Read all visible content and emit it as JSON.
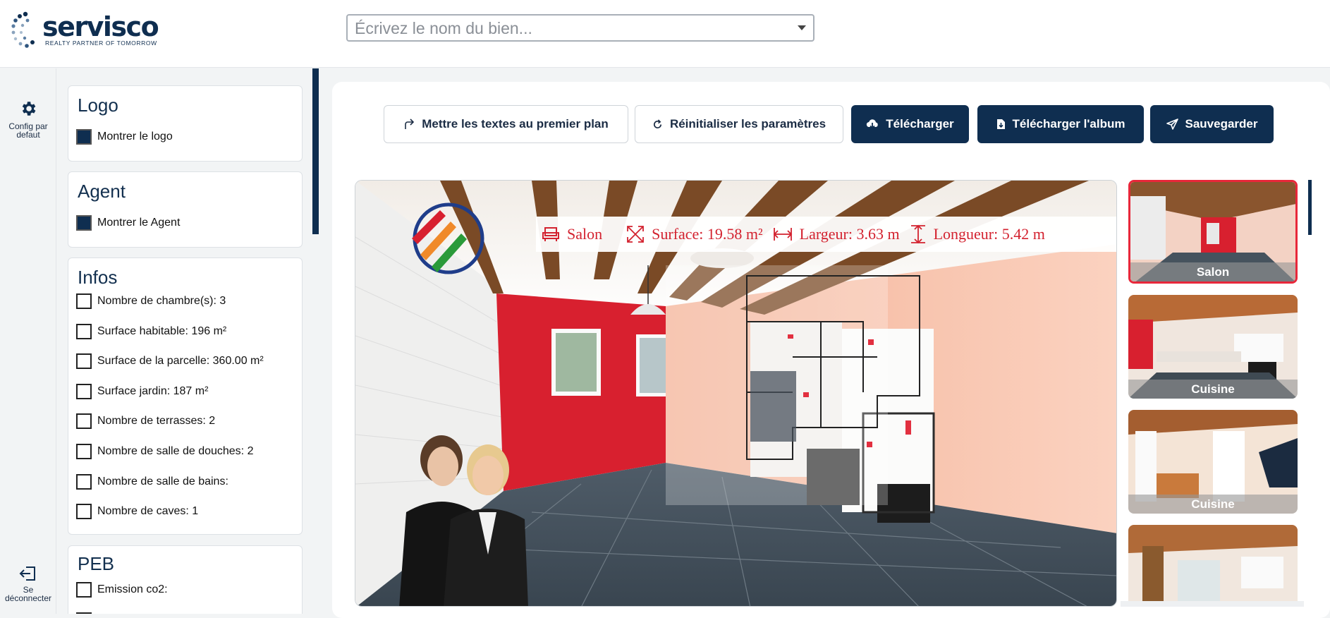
{
  "header": {
    "brand": "servisco",
    "tagline": "REALTY PARTNER OF TOMORROW",
    "search_placeholder": "Écrivez le nom du bien..."
  },
  "rail": {
    "config_label": "Config par defaut",
    "logout_label": "Se déconnecter"
  },
  "panels": {
    "logo": {
      "title": "Logo",
      "option": "Montrer le logo",
      "checked": true
    },
    "agent": {
      "title": "Agent",
      "option": "Montrer le Agent",
      "checked": true
    },
    "infos": {
      "title": "Infos",
      "items": [
        {
          "label": "Nombre de chambre(s): 3"
        },
        {
          "label": "Surface habitable: 196 m²"
        },
        {
          "label": "Surface de la parcelle: 360.00 m²"
        },
        {
          "label": "Surface jardin: 187 m²"
        },
        {
          "label": "Nombre de terrasses: 2"
        },
        {
          "label": "Nombre de salle de douches: 2"
        },
        {
          "label": "Nombre de salle de bains:"
        },
        {
          "label": "Nombre de caves: 1"
        }
      ]
    },
    "peb": {
      "title": "PEB",
      "items": [
        {
          "label": "Emission co2:"
        }
      ]
    }
  },
  "toolbar": {
    "bring_front": "Mettre les textes au premier plan",
    "reset": "Réinitialiser les paramètres",
    "download": "Télécharger",
    "download_album": "Télécharger l'album",
    "save": "Sauvegarder"
  },
  "photo": {
    "room": "Salon",
    "surface": "Surface: 19.58 m²",
    "width": "Largeur: 3.63 m",
    "length": "Longueur: 5.42 m"
  },
  "thumbnails": [
    {
      "caption": "Salon",
      "selected": true
    },
    {
      "caption": "Cuisine",
      "selected": false
    },
    {
      "caption": "Cuisine",
      "selected": false
    },
    {
      "caption": "",
      "selected": false
    }
  ],
  "colors": {
    "brand_navy": "#0f2e50",
    "accent_red": "#d3222f",
    "selected_border": "#e8273a"
  }
}
